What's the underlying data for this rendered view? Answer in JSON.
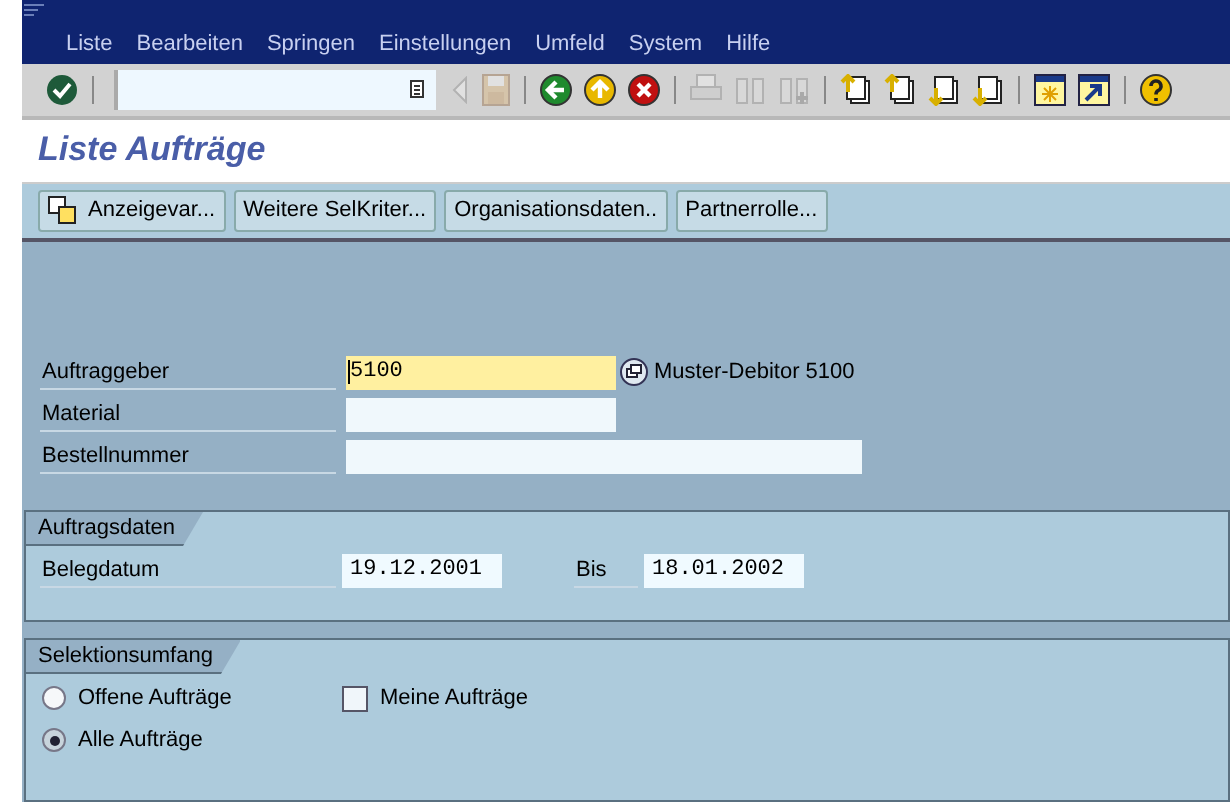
{
  "menu": [
    {
      "label": "Liste"
    },
    {
      "label": "Bearbeiten"
    },
    {
      "label": "Springen"
    },
    {
      "label": "Einstellungen"
    },
    {
      "label": "Umfeld"
    },
    {
      "label": "System"
    },
    {
      "label": "Hilfe"
    }
  ],
  "toolbar": {
    "icons": [
      {
        "kind": "enter",
        "disabled": false
      },
      {
        "kind": "back-small",
        "disabled": true
      },
      {
        "kind": "save",
        "disabled": true
      },
      {
        "kind": "back",
        "disabled": false
      },
      {
        "kind": "up",
        "disabled": false
      },
      {
        "kind": "cancel",
        "disabled": false
      },
      {
        "kind": "print",
        "disabled": true
      },
      {
        "kind": "find",
        "disabled": true
      },
      {
        "kind": "find-next",
        "disabled": true
      },
      {
        "kind": "first",
        "disabled": false
      },
      {
        "kind": "prev",
        "disabled": false
      },
      {
        "kind": "next",
        "disabled": false
      },
      {
        "kind": "last",
        "disabled": false
      },
      {
        "kind": "window",
        "disabled": false
      },
      {
        "kind": "shortcut",
        "disabled": false
      },
      {
        "kind": "help",
        "disabled": false
      }
    ]
  },
  "title": "Liste Aufträge",
  "app_buttons": [
    {
      "label": "Anzeigevar...",
      "icon": true
    },
    {
      "label": "Weitere SelKriter...",
      "icon": false
    },
    {
      "label": "Organisationsdaten..",
      "icon": false
    },
    {
      "label": "Partnerrolle...",
      "icon": false
    }
  ],
  "fields": [
    {
      "label": "Auftraggeber",
      "value": "5100",
      "focused": true,
      "wide": false,
      "description": "Muster-Debitor 5100"
    },
    {
      "label": "Material",
      "focused": false,
      "wide": false
    },
    {
      "label": "Bestellnummer",
      "focused": false,
      "wide": true
    }
  ],
  "order_data": {
    "title": "Auftragsdaten",
    "label": "Belegdatum",
    "from": "19.12.2001",
    "to_label": "Bis",
    "to": "18.01.2002"
  },
  "selection": {
    "title": "Selektionsumfang",
    "options": [
      {
        "label": "Offene Aufträge",
        "selected": false
      },
      {
        "label": "Alle Aufträge",
        "selected": true
      }
    ],
    "checkbox": {
      "label": "Meine Aufträge",
      "checked": false
    }
  }
}
